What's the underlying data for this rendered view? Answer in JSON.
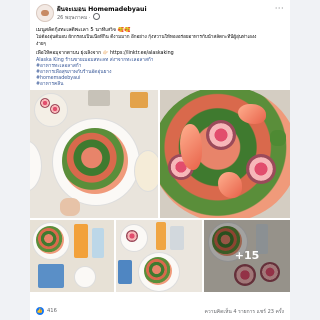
{
  "post": {
    "author": "ฝันจะเมอน Homemadebyaui",
    "time": "26 พฤษภาคม",
    "more_icon": "ellipsis-icon",
    "lines": [
      "เมนูสลัดกุ้งทะเลตีพะเลา 5 นาทีเสร็จ 🥰🥰",
      "ไม่ต้องอุ่นต้มอบ ผักกรอบเป็นเนื้อที่ก็น ดีงามมาก อีกอย่าง กุ้งหวานให้ทองอร่อยอาหารกับน้ำสลัดกะที่นี่ผู้อุ่นท่าเองง",
      "ง่ายๆ"
    ],
    "recipe_line": "เพื่อให้คอมุจากตาบน ยุ่งเลิ้งจาก 👉🏻 https://linktr.ee/alaskaking",
    "hashtag_lines": [
      "Alaska King ร้านขายเมอมสทะลท ส่งฯจากทะเลอลาสก้า",
      "#อาหารทะเลอลาสก้า",
      "#อาหารเพื่อสุขภาพกับร้านอัดอุ่นยาง",
      "#homemadebyaui",
      "#อาหารคลีน"
    ],
    "more_photos": "+15",
    "likes": "416",
    "stats": "ความคิดเห็น 4 รายการ  แชร์ 23 ครั้ง"
  }
}
